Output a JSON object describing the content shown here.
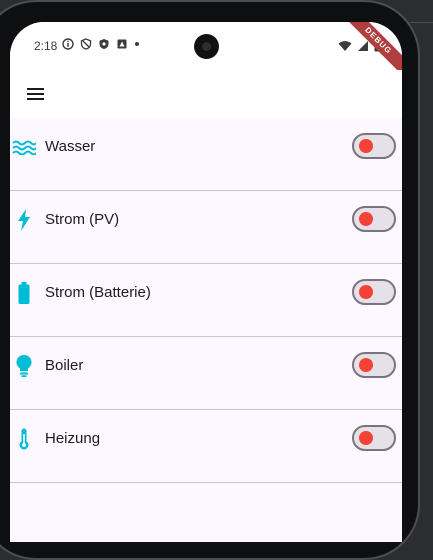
{
  "status_bar": {
    "time": "2:18"
  },
  "debug_banner": {
    "label": "DEBUG"
  },
  "app_bar": {
    "menu_icon": "hamburger-menu-icon"
  },
  "devices": [
    {
      "label": "Wasser",
      "icon": "water-waves-icon",
      "on": false
    },
    {
      "label": "Strom (PV)",
      "icon": "lightning-bolt-icon",
      "on": false
    },
    {
      "label": "Strom (Batterie)",
      "icon": "battery-icon",
      "on": false
    },
    {
      "label": "Boiler",
      "icon": "lightbulb-icon",
      "on": false
    },
    {
      "label": "Heizung",
      "icon": "thermometer-icon",
      "on": false
    }
  ],
  "colors": {
    "icon_accent": "#00bcd4",
    "switch_thumb_off": "#f44336",
    "list_background": "#fdf7ff",
    "divider": "#cac4d0"
  }
}
